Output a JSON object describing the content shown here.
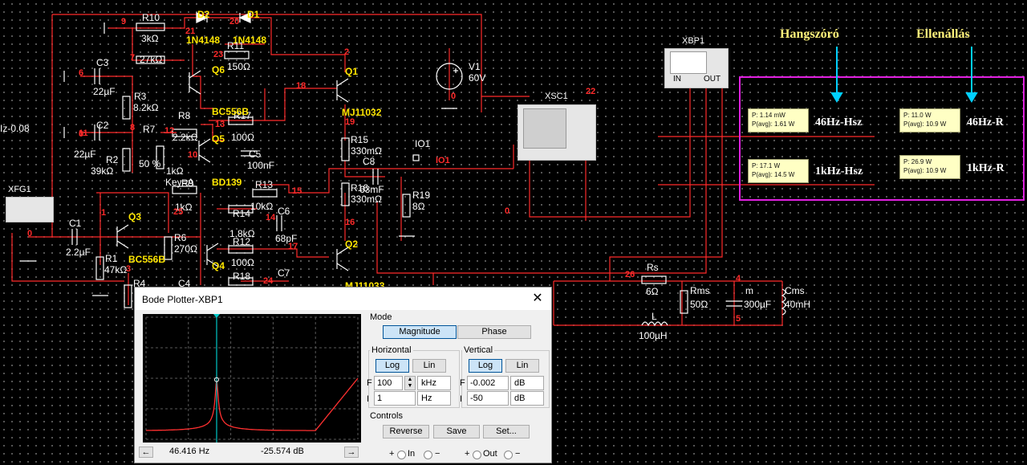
{
  "schematic": {
    "components": {
      "R10": {
        "ref": "R10",
        "value": "3kΩ",
        "value2": "27kΩ"
      },
      "D2": {
        "ref": "D2",
        "model": "1N4148"
      },
      "D1": {
        "ref": "D1",
        "model": "1N4148"
      },
      "R11": {
        "ref": "R11",
        "value": "150Ω"
      },
      "C3": {
        "ref": "C3",
        "value": "22µF"
      },
      "R3": {
        "ref": "R3",
        "value": "8.2kΩ"
      },
      "C2": {
        "ref": "C2",
        "value": "22µF"
      },
      "R2": {
        "ref": "R2",
        "value": "39kΩ"
      },
      "R7": {
        "ref": "R7",
        "pct": "50 %",
        "value": "1kΩ",
        "key": "Key=A"
      },
      "R8": {
        "ref": "R8",
        "value": "2.2kΩ"
      },
      "R17": {
        "ref": "R17",
        "value": "100Ω"
      },
      "C5": {
        "ref": "C5",
        "value": "100nF"
      },
      "R13": {
        "ref": "R13",
        "value": "10kΩ"
      },
      "R14": {
        "ref": "R14",
        "value": "1.8kΩ"
      },
      "C6": {
        "ref": "C6",
        "value": "68pF"
      },
      "R12": {
        "ref": "R12",
        "value": "100Ω"
      },
      "R18": {
        "ref": "R18"
      },
      "C7": {
        "ref": "C7"
      },
      "R9": {
        "ref": "R9",
        "value": "1kΩ"
      },
      "Q6": {
        "ref": "Q6",
        "model": "BC556B"
      },
      "Q5": {
        "ref": "Q5",
        "model": "BD139"
      },
      "Q3": {
        "ref": "Q3",
        "model": "BC556B"
      },
      "Q4": {
        "ref": "Q4"
      },
      "Q1": {
        "ref": "Q1",
        "model": "MJ11032"
      },
      "Q2": {
        "ref": "Q2",
        "model": "MJ11033"
      },
      "V1": {
        "ref": "V1",
        "value": "60V"
      },
      "R15": {
        "ref": "R15",
        "value": "330mΩ"
      },
      "R16": {
        "ref": "R16",
        "value": "330mΩ"
      },
      "C8": {
        "ref": "C8",
        "value": "63mF"
      },
      "R19": {
        "ref": "R19",
        "value": "8Ω"
      },
      "R6": {
        "ref": "R6",
        "value": "270Ω"
      },
      "C1": {
        "ref": "C1",
        "value": "2.2µF"
      },
      "R1": {
        "ref": "R1",
        "value": "47kΩ"
      },
      "R4": {
        "ref": "R4"
      },
      "C4": {
        "ref": "C4"
      },
      "XFG1": {
        "ref": "XFG1"
      },
      "XSC1": {
        "ref": "XSC1"
      },
      "XBP1": {
        "ref": "XBP1",
        "in": "IN",
        "out": "OUT"
      },
      "IO1": {
        "ref": "IO1",
        "net": "IO1"
      },
      "Rs": {
        "ref": "Rs",
        "value": "6Ω"
      },
      "L": {
        "ref": "L",
        "value": "100µH"
      },
      "Rms": {
        "ref": "Rms",
        "value": "50Ω"
      },
      "m": {
        "ref": "m",
        "value": "300µF"
      },
      "Cms": {
        "ref": "Cms",
        "value": "40mH"
      }
    },
    "nets": [
      "9",
      "20",
      "21",
      "23",
      "7",
      "8",
      "6",
      "12",
      "13",
      "10",
      "15",
      "14",
      "11",
      "25",
      "1",
      "3",
      "18",
      "19",
      "16",
      "17",
      "24",
      "2",
      "0",
      "22",
      "26",
      "4",
      "5"
    ],
    "side_text": "Iz-0.08",
    "annotations": {
      "hangszoro": "Hangszóró",
      "ellenallas": "Ellenállás"
    },
    "probes": [
      {
        "p": "P: 1.14 mW",
        "pavg": "P(avg): 1.61 W",
        "label": "46Hz-Hsz"
      },
      {
        "p": "P: 11.0 W",
        "pavg": "P(avg): 10.9 W",
        "label": "46Hz-R"
      },
      {
        "p": "P: 17.1 W",
        "pavg": "P(avg): 14.5 W",
        "label": "1kHz-Hsz"
      },
      {
        "p": "P: 26.9 W",
        "pavg": "P(avg): 10.9 W",
        "label": "1kHz-R"
      }
    ],
    "colors": {
      "wire": "#ff2a2a",
      "net_label": "#ff2a2a",
      "component": "#ffffff",
      "part_label": "#ffe600",
      "box": "#e020e0",
      "arrow": "#00d0ff"
    }
  },
  "bode": {
    "title": "Bode Plotter-XBP1",
    "close_label": "✕",
    "mode": {
      "label": "Mode",
      "magnitude": "Magnitude",
      "phase": "Phase",
      "active": "magnitude"
    },
    "horizontal": {
      "label": "Horizontal",
      "log": "Log",
      "lin": "Lin",
      "active": "log",
      "F": "F",
      "F_value": "100",
      "F_unit": "kHz",
      "I": "I",
      "I_value": "1",
      "I_unit": "Hz"
    },
    "vertical": {
      "label": "Vertical",
      "log": "Log",
      "lin": "Lin",
      "active": "log",
      "F": "F",
      "F_value": "-0.002",
      "F_unit": "dB",
      "I": "I",
      "I_value": "-50",
      "I_unit": "dB"
    },
    "controls": {
      "label": "Controls",
      "reverse": "Reverse",
      "save": "Save",
      "set": "Set..."
    },
    "io": {
      "plus": "+",
      "in": "In",
      "minus": "−",
      "out": "Out"
    },
    "cursor": {
      "freq": "46.416  Hz",
      "gain": "-25.574 dB",
      "left": "←",
      "right": "→"
    },
    "plot": {
      "x_log_range_hz": [
        1,
        100000
      ],
      "y_range_db": [
        -50,
        -0.002
      ],
      "cursor_hz": 46.416,
      "cursor_db": -25.574,
      "trace_color": "#ff3030",
      "cursor_color": "#00c8c8"
    }
  }
}
